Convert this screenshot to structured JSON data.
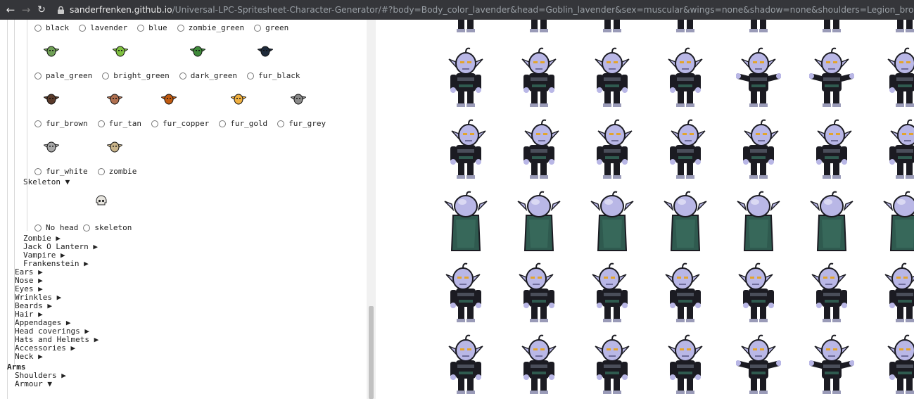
{
  "browser": {
    "host": "sanderfrenken.github.io",
    "path": "/Universal-LPC-Spritesheet-Character-Generator/#?body=Body_color_lavender&head=Goblin_lavender&sex=muscular&wings=none&shadow=none&shoulders=Legion_bronze&arms=Armour_iron&ba"
  },
  "colors": {
    "lavender": "#b9b7e6",
    "dark": "#1b1b22",
    "cloak": "#2f5a4f",
    "eye": "#e3a42c"
  },
  "variant_rows": [
    {
      "options": [
        "black",
        "lavender",
        "blue",
        "zombie_green",
        "green"
      ],
      "swatches": [
        "#6fa055",
        "#7fc040",
        "#3f8a3a",
        "#1e2a3a"
      ]
    },
    {
      "options": [
        "pale_green",
        "bright_green",
        "dark_green",
        "fur_black"
      ],
      "swatches": [
        "#5a3a2a",
        "#b07050",
        "#c05a10",
        "#f0b040",
        "#8a8a8a"
      ]
    },
    {
      "options": [
        "fur_brown",
        "fur_tan",
        "fur_copper",
        "fur_gold",
        "fur_grey"
      ],
      "swatches": [
        "#a9a9a9",
        "#c9b48a"
      ]
    },
    {
      "options": [
        "fur_white",
        "zombie"
      ],
      "swatches": []
    }
  ],
  "skeleton": {
    "label": "Skeleton ▼",
    "options": [
      "No head",
      "skeleton"
    ],
    "swatch": "#e8e6e0"
  },
  "head_collapsed": [
    "Zombie ▶",
    "Jack O Lantern ▶",
    "Vampire ▶",
    "Frankenstein ▶"
  ],
  "head_sections": [
    "Ears ▶",
    "Nose ▶",
    "Eyes ▶",
    "Wrinkles ▶",
    "Beards ▶",
    "Hair ▶",
    "Appendages ▶",
    "Head coverings ▶",
    "Hats and Helmets ▶",
    "Accessories ▶",
    "Neck ▶"
  ],
  "arms": {
    "title": "Arms",
    "items": [
      "Shoulders ▶",
      "Armour ▼"
    ]
  }
}
